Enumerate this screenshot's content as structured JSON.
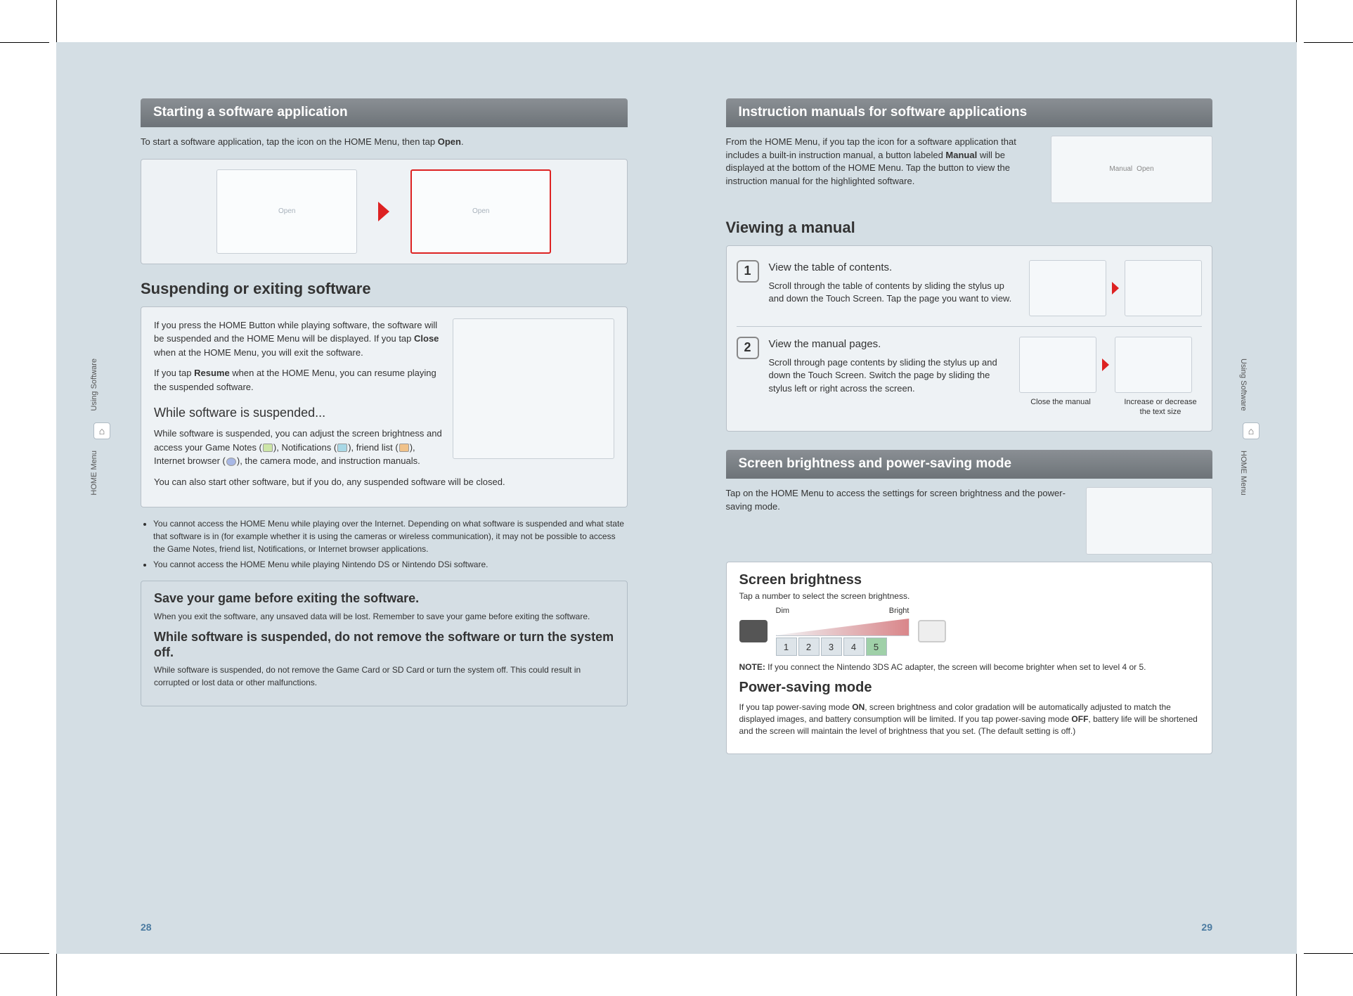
{
  "left": {
    "h1": "Starting a software application",
    "intro": "To start a software application, tap the icon on the HOME Menu, then tap ",
    "intro_b": "Open",
    "intro_end": ".",
    "img_left_caption": "Open",
    "img_right_caption": "Open",
    "h2_suspend": "Suspending or exiting software",
    "p1a": "If you press the HOME Button while playing software, the software will be suspended and the HOME Menu will be displayed. If you tap ",
    "p1b": "Close",
    "p1c": " when at the HOME Menu, you will exit the software.",
    "p2a": "If you tap ",
    "p2b": "Resume",
    "p2c": " when at the HOME Menu, you can resume playing the suspended software.",
    "h3_while": "While software is suspended...",
    "p3a": "While software is suspended, you can adjust the screen brightness and access your Game Notes (",
    "p3b": "), Notifications (",
    "p3c": "), friend list (",
    "p3d": "), Internet browser (",
    "p3e": "), the camera mode, and instruction manuals.",
    "p4": "You can also start other software, but if you do, any suspended software will be closed.",
    "bullets": [
      "You cannot access the HOME Menu while playing over the Internet. Depending on what software is suspended and what state that software is in (for example whether it is using the cameras or wireless communication), it may not be possible to access the Game Notes, friend list, Notifications, or Internet browser applications.",
      "You cannot access the HOME Menu while playing Nintendo DS or Nintendo DSi software."
    ],
    "warn": {
      "h3a": "Save your game before exiting the software.",
      "p1": "When you exit the software, any unsaved data will be lost. Remember to save your game before exiting the software.",
      "h3b": "While software is suspended, do not remove the software or turn the system off.",
      "p2": "While software is suspended, do not remove the Game Card or SD Card or turn the system off. This could result in corrupted or lost data or other malfunctions."
    },
    "pagenum": "28"
  },
  "right": {
    "h1": "Instruction manuals for software applications",
    "intro_a": "From the HOME Menu, if you tap the icon for a software application that includes a built-in instruction manual, a button labeled ",
    "intro_b": "Manual",
    "intro_c": " will be displayed at the bottom of the HOME Menu. Tap the button to view the instruction manual for the highlighted software.",
    "right_img_labels": {
      "manual": "Manual",
      "open": "Open"
    },
    "h2_viewing": "Viewing a manual",
    "steps": [
      {
        "n": "1",
        "title": "View the table of contents.",
        "body": "Scroll through the table of contents by sliding the stylus up and down the Touch Screen. Tap the page you want to view."
      },
      {
        "n": "2",
        "title": "View the manual pages.",
        "body": "Scroll through page contents by sliding the stylus up and down the Touch Screen. Switch the page by sliding the stylus left or right across the screen."
      }
    ],
    "cap_close": "Close the manual",
    "cap_zoom": "Increase or decrease the text size",
    "h1b": "Screen brightness and power-saving mode",
    "tap_intro": "Tap        on the HOME Menu to access the settings for screen brightness and the power-saving mode.",
    "h3_bright": "Screen brightness",
    "bright_sub": "Tap a number to select the screen brightness.",
    "dim": "Dim",
    "bright": "Bright",
    "nums": [
      "1",
      "2",
      "3",
      "4",
      "5"
    ],
    "note_b": "NOTE:",
    "note_txt": " If you connect the Nintendo 3DS AC adapter, the screen will become brighter when set to level 4 or 5.",
    "h3_power": "Power-saving mode",
    "power_a": "If you tap power-saving mode ",
    "power_on": "ON",
    "power_b": ", screen brightness and color gradation will be automatically adjusted to match the displayed images, and battery consumption will be limited. If you tap power-saving mode ",
    "power_off": "OFF",
    "power_c": ", battery life will be shortened and the screen will maintain the level of brightness that you set. (The default setting is off.)",
    "pagenum": "29"
  },
  "side": {
    "using": "Using Software",
    "home": "HOME Menu",
    "home_icon": "⌂"
  }
}
